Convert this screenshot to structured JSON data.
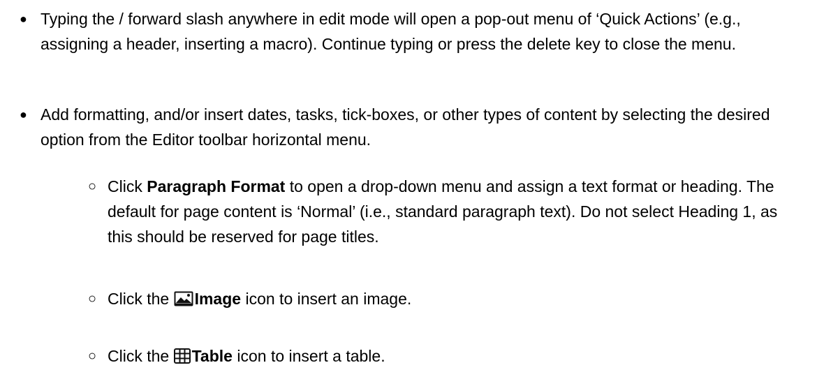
{
  "bullets": [
    {
      "text": "Typing the / forward slash anywhere in edit mode will open a pop-out menu of ‘Quick Actions’ (e.g., assigning a header, inserting a macro). Continue typing or press the delete key to close the menu."
    },
    {
      "text": "Add formatting, and/or insert dates, tasks, tick-boxes, or other types of content by selecting the desired option from the Editor toolbar horizontal menu."
    }
  ],
  "sub_bullets": [
    {
      "prefix": "Click ",
      "bold": "Paragraph Format",
      "suffix": " to open a drop-down menu and assign a text format or heading. The default for page content is ‘Normal’ (i.e., standard paragraph text). Do not select Heading 1, as this should be reserved for page titles."
    },
    {
      "prefix": "Click the ",
      "icon": "image-icon",
      "bold": "Image",
      "suffix": " icon to insert an image."
    },
    {
      "prefix": "Click the ",
      "icon": "table-icon",
      "bold": "Table",
      "suffix": " icon to insert a table."
    }
  ],
  "bullet_glyphs": {
    "level1": "●",
    "level2": "○"
  }
}
